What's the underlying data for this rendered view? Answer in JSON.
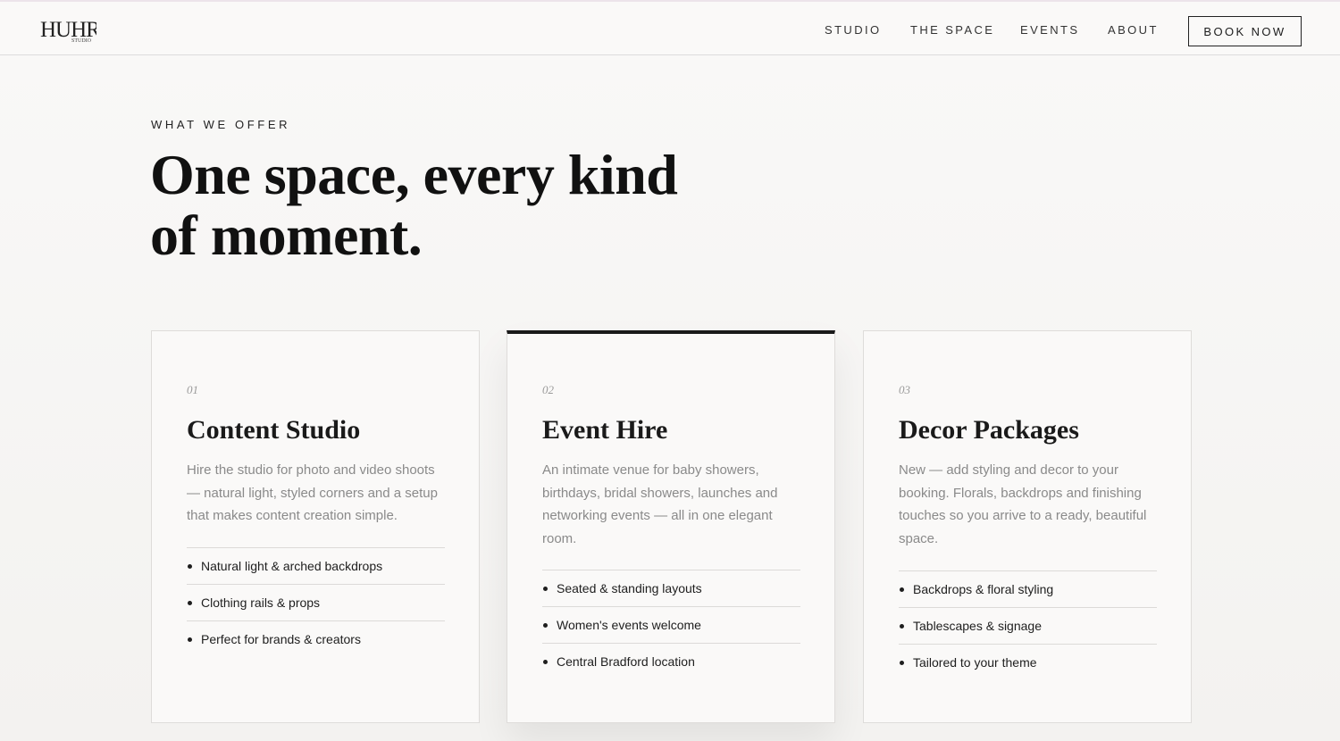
{
  "nav": {
    "logo_text": "HUHR",
    "logo_sub": "STUDIO",
    "links": [
      "STUDIO",
      "THE SPACE",
      "EVENTS",
      "ABOUT"
    ],
    "cta": "BOOK NOW"
  },
  "hero": {
    "eyebrow": "WHAT WE OFFER",
    "headline_line1": "One space, every kind",
    "headline_line2": "of moment."
  },
  "cards": [
    {
      "number": "01",
      "title": "Content Studio",
      "description": "Hire the studio for photo and video shoots — natural light, styled corners and a setup that makes content creation simple.",
      "features": [
        "Natural light & arched backdrops",
        "Clothing rails & props",
        "Perfect for brands & creators"
      ]
    },
    {
      "number": "02",
      "title": "Event Hire",
      "description": "An intimate venue for baby showers, birthdays, bridal showers, launches and networking events — all in one elegant room.",
      "features": [
        "Seated & standing layouts",
        "Women's events welcome",
        "Central Bradford location"
      ]
    },
    {
      "number": "03",
      "title": "Decor Packages",
      "description": "New — add styling and decor to your booking. Florals, backdrops and finishing touches so you arrive to a ready, beautiful space.",
      "features": [
        "Backdrops & floral styling",
        "Tablescapes & signage",
        "Tailored to your theme"
      ]
    }
  ]
}
